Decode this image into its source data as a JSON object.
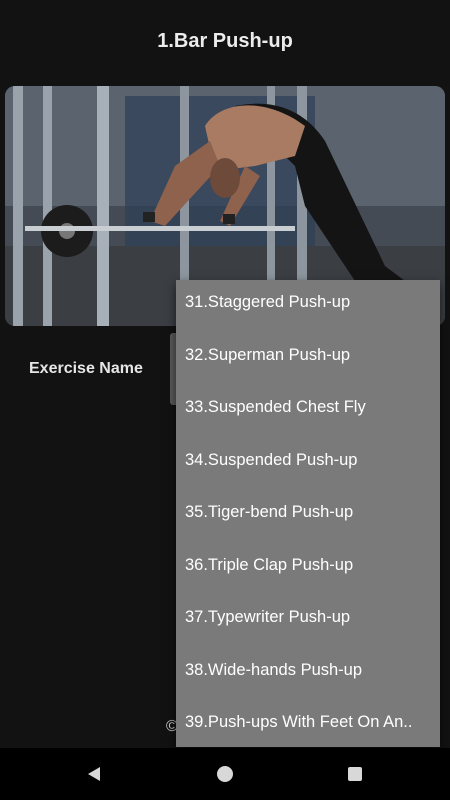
{
  "header": {
    "title": "1.Bar Push-up"
  },
  "detail": {
    "exercise_name_label": "Exercise Name",
    "copyright_symbol": "©"
  },
  "dropdown": {
    "options": [
      "31.Staggered Push-up",
      "32.Superman Push-up",
      "33.Suspended Chest Fly",
      "34.Suspended Push-up",
      "35.Tiger-bend Push-up",
      "36.Triple Clap Push-up",
      "37.Typewriter Push-up",
      "38.Wide-hands Push-up",
      "39.Push-ups With Feet On An.."
    ]
  },
  "navbar": {
    "icons": [
      "back-triangle-icon",
      "home-circle-icon",
      "recents-square-icon"
    ]
  },
  "colors": {
    "background": "#121212",
    "dropdown": "#7a7a7a",
    "navbar": "#000000"
  }
}
